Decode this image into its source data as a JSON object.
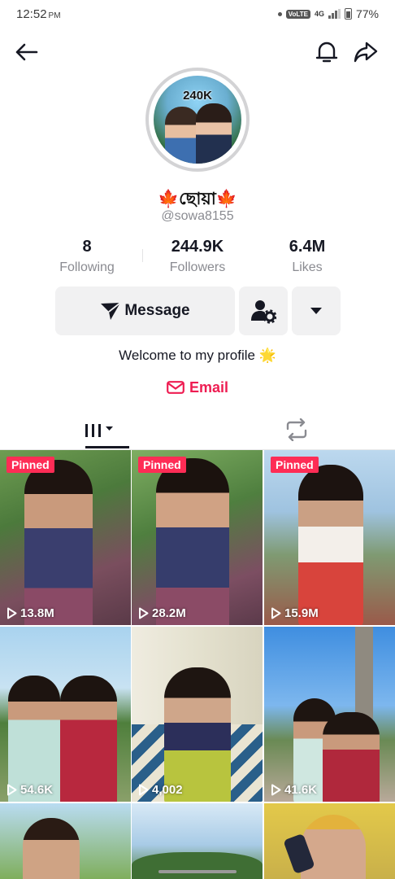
{
  "status": {
    "time": "12:52",
    "ampm": "PM",
    "volte": "VoLTE",
    "network": "4G",
    "battery": "77%"
  },
  "header": {
    "back_icon": "arrow-left-icon",
    "bell_icon": "bell-icon",
    "share_icon": "share-arrow-icon"
  },
  "profile": {
    "avatar_badge": "240K",
    "display_name": "🍁ছোয়া🍁",
    "username": "@sowa8155",
    "bio": "Welcome to my profile 🌟",
    "email_label": "Email"
  },
  "stats": [
    {
      "value": "8",
      "label": "Following"
    },
    {
      "value": "244.9K",
      "label": "Followers"
    },
    {
      "value": "6.4M",
      "label": "Likes"
    }
  ],
  "actions": {
    "message_label": "Message"
  },
  "tabs": [
    {
      "icon": "videos-grid-icon",
      "active": true
    },
    {
      "icon": "repost-icon",
      "active": false
    }
  ],
  "videos": [
    {
      "pinned": "Pinned",
      "views": "13.8M"
    },
    {
      "pinned": "Pinned",
      "views": "28.2M"
    },
    {
      "pinned": "Pinned",
      "views": "15.9M"
    },
    {
      "views": "54.6K"
    },
    {
      "views": "4,002"
    },
    {
      "views": "41.6K"
    },
    {},
    {},
    {}
  ],
  "colors": {
    "accent": "#fe2c55",
    "email": "#ee1d52",
    "button_bg": "#f1f1f2",
    "muted_text": "#8a8b91"
  }
}
